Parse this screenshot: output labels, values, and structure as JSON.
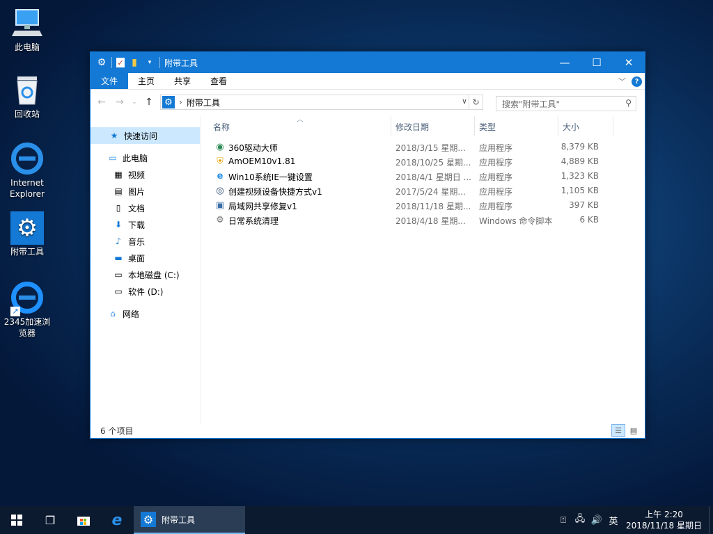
{
  "desktop": {
    "icons": [
      {
        "label": "此电脑",
        "icon": "computer-icon"
      },
      {
        "label": "回收站",
        "icon": "recycle-bin-icon"
      },
      {
        "label": "Internet Explorer",
        "icon": "ie-icon"
      },
      {
        "label": "附带工具",
        "icon": "gear-icon"
      },
      {
        "label": "2345加速浏览器",
        "icon": "browser-shortcut-icon"
      }
    ]
  },
  "window": {
    "title": "附带工具",
    "ribbon_tabs": [
      "文件",
      "主页",
      "共享",
      "查看"
    ],
    "address_path": "附带工具",
    "search_placeholder": "搜索\"附带工具\"",
    "nav": {
      "quick_access": "快速访问",
      "this_pc": "此电脑",
      "items": [
        "视频",
        "图片",
        "文档",
        "下载",
        "音乐",
        "桌面",
        "本地磁盘 (C:)",
        "软件 (D:)"
      ],
      "network": "网络"
    },
    "columns": {
      "name": "名称",
      "date": "修改日期",
      "type": "类型",
      "size": "大小"
    },
    "files": [
      {
        "name": "360驱动大师",
        "date": "2018/3/15 星期...",
        "type": "应用程序",
        "size": "8,379 KB",
        "icon": "360-driver-icon"
      },
      {
        "name": "AmOEM10v1.81",
        "date": "2018/10/25 星期...",
        "type": "应用程序",
        "size": "4,889 KB",
        "icon": "shield-icon"
      },
      {
        "name": "Win10系统IE一键设置",
        "date": "2018/4/1 星期日 ...",
        "type": "应用程序",
        "size": "1,323 KB",
        "icon": "ie-icon"
      },
      {
        "name": "创建视频设备快捷方式v1",
        "date": "2017/5/24 星期...",
        "type": "应用程序",
        "size": "1,105 KB",
        "icon": "camera-icon"
      },
      {
        "name": "局域网共享修复v1",
        "date": "2018/11/18 星期...",
        "type": "应用程序",
        "size": "397 KB",
        "icon": "network-share-icon"
      },
      {
        "name": "日常系统清理",
        "date": "2018/4/18 星期...",
        "type": "Windows 命令脚本",
        "size": "6 KB",
        "icon": "script-icon"
      }
    ],
    "status": "6 个项目"
  },
  "taskbar": {
    "app_label": "附带工具",
    "ime": "英",
    "time": "上午 2:20",
    "date": "2018/11/18 星期日"
  }
}
